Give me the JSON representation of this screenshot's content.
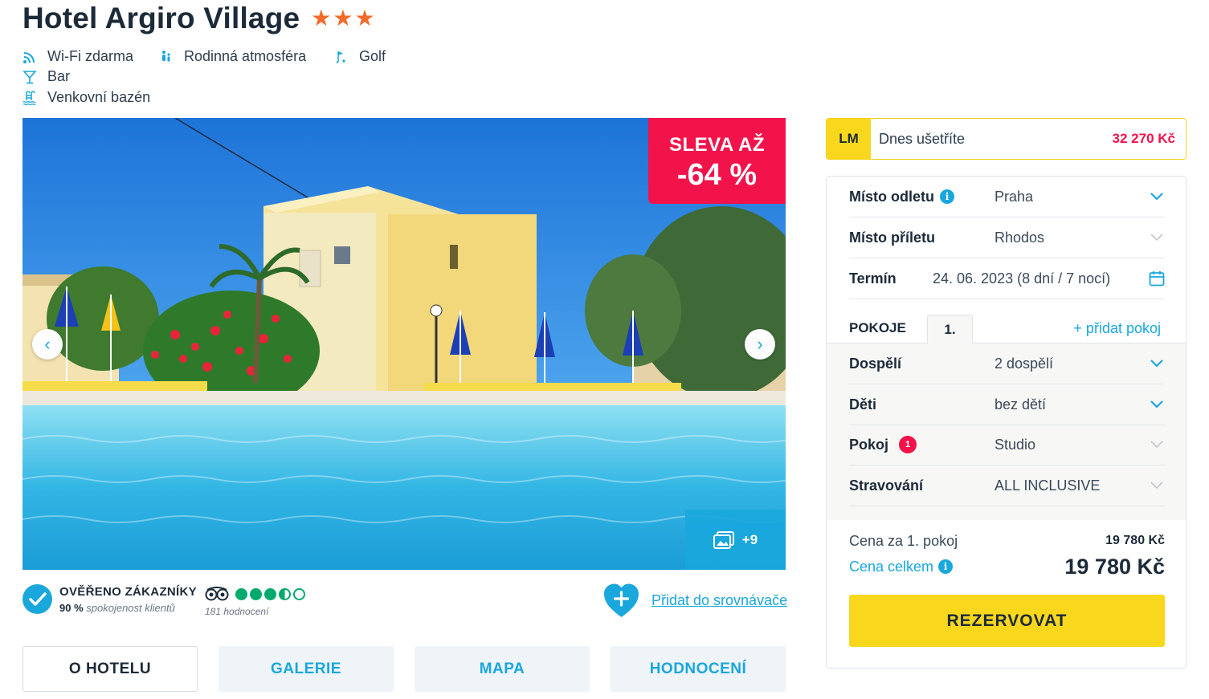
{
  "hotel": {
    "name": "Hotel Argiro Village",
    "stars": [
      "★",
      "★",
      "★"
    ]
  },
  "amenities": {
    "wifi": "Wi-Fi zdarma",
    "family": "Rodinná atmosféra",
    "golf": "Golf",
    "bar": "Bar",
    "pool": "Venkovní bazén"
  },
  "gallery": {
    "discount_label": "SLEVA AŽ",
    "discount_value": "-64 %",
    "prev_arrow": "‹",
    "next_arrow": "›",
    "more_photos": "+9"
  },
  "verified": {
    "title": "OVĚŘENO ZÁKAZNÍKY",
    "percent": "90 %",
    "subtitle": "spokojenost klientů"
  },
  "tripadvisor": {
    "rating_bubbles": 3.5,
    "reviews": "181 hodnocení"
  },
  "compare": {
    "link": "Přidat do srovnávače"
  },
  "tabs": [
    "O HOTELU",
    "GALERIE",
    "MAPA",
    "HODNOCENÍ"
  ],
  "lastminute": {
    "badge": "LM",
    "text": "Dnes ušetříte",
    "saving": "32 270 Kč"
  },
  "booking": {
    "departure_label": "Místo odletu",
    "departure_value": "Praha",
    "arrival_label": "Místo příletu",
    "arrival_value": "Rhodos",
    "date_label": "Termín",
    "date_value": "24. 06. 2023 (8 dní / 7 nocí)",
    "rooms_label": "POKOJE",
    "room_tab": "1.",
    "add_room": "+ přidat pokoj",
    "adults_label": "Dospělí",
    "adults_value": "2 dospělí",
    "children_label": "Děti",
    "children_value": "bez dětí",
    "room_label": "Pokoj",
    "room_badge": "1",
    "room_value": "Studio",
    "board_label": "Stravování",
    "board_value": "ALL INCLUSIVE",
    "price_room_label": "Cena za 1. pokoj",
    "price_room_value": "19 780 Kč",
    "price_total_label": "Cena celkem",
    "price_total_value": "19 780 Kč",
    "reserve_button": "REZERVOVAT"
  },
  "colors": {
    "accent": "#19a7dc",
    "stars": "#f26b2a",
    "discount": "#f2134b",
    "button": "#f9d71c",
    "tripadvisor": "#00aa6c"
  }
}
